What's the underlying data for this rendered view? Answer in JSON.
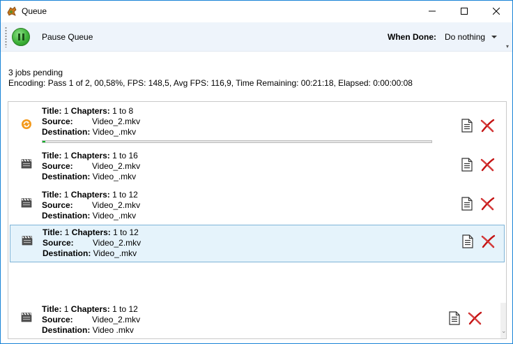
{
  "window": {
    "title": "Queue"
  },
  "toolbar": {
    "pause_label": "Pause Queue",
    "when_done_label": "When Done:",
    "when_done_value": "Do nothing"
  },
  "status": {
    "pending": "3 jobs pending",
    "encoding": "Encoding: Pass 1 of 2,  00,58%,  FPS: 148,5,   Avg FPS: 116,9,  Time Remaining: 00:21:18,  Elapsed: 0:00:00:08"
  },
  "labels": {
    "title": "Title:",
    "chapters": "Chapters:",
    "to": "to",
    "source": "Source:",
    "destination": "Destination:"
  },
  "jobs": [
    {
      "title": "1",
      "chap_from": "1",
      "chap_to": "8",
      "source": "Video_2.mkv",
      "destination": "Video_.mkv",
      "state": "encoding",
      "progress": 0.0058
    },
    {
      "title": "1",
      "chap_from": "1",
      "chap_to": "16",
      "source": "Video_2.mkv",
      "destination": "Video_.mkv",
      "state": "pending"
    },
    {
      "title": "1",
      "chap_from": "1",
      "chap_to": "12",
      "source": "Video_2.mkv",
      "destination": "Video_.mkv",
      "state": "pending"
    },
    {
      "title": "1",
      "chap_from": "1",
      "chap_to": "12",
      "source": "Video_2.mkv",
      "destination": "Video_.mkv",
      "state": "pending",
      "selected": true
    },
    {
      "title": "1",
      "chap_from": "1",
      "chap_to": "12",
      "source": "Video_2.mkv",
      "destination": "Video .mkv",
      "state": "pending"
    }
  ],
  "icons": {
    "encoding": "refresh-icon",
    "pending": "clapperboard-icon",
    "edit": "document-icon",
    "delete": "red-x-icon"
  },
  "colors": {
    "accent": "#1883d7",
    "progress": "#06b025",
    "selection": "#e5f3fb",
    "delete": "#d01818"
  }
}
